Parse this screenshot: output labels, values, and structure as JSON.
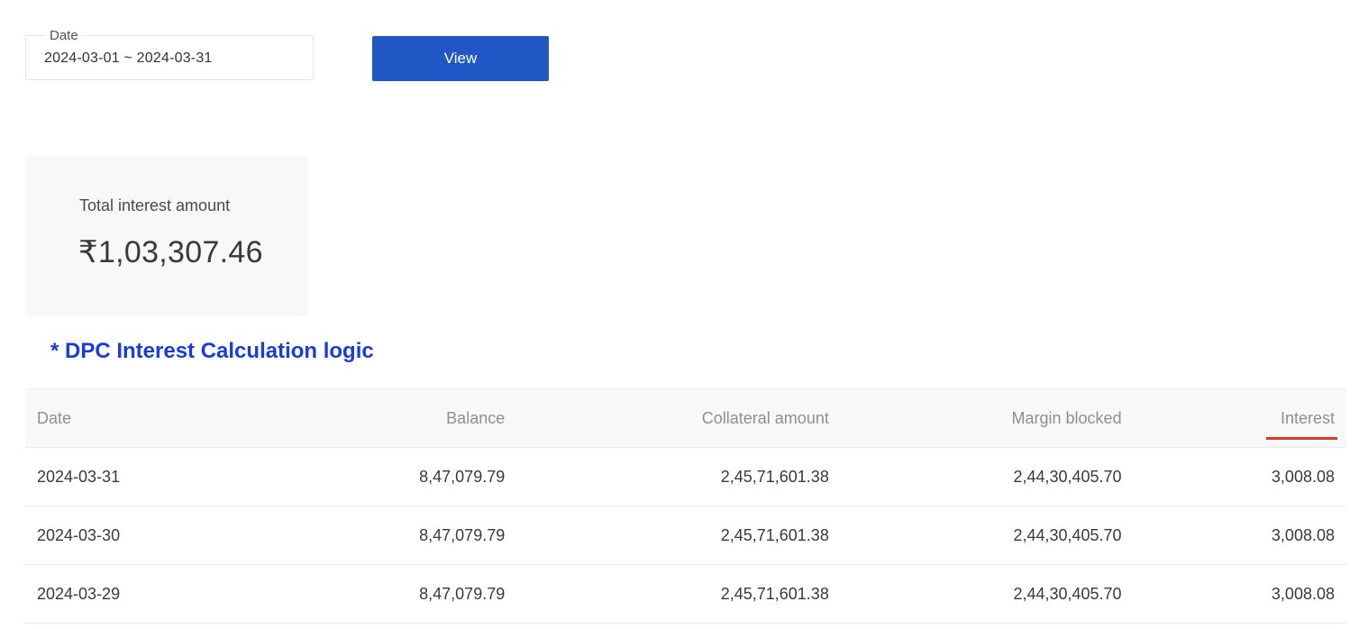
{
  "filter": {
    "date_label": "Date",
    "date_value": "2024-03-01 ~ 2024-03-31",
    "view_button_label": "View"
  },
  "summary": {
    "label": "Total interest amount",
    "amount": "₹1,03,307.46"
  },
  "logic_link": {
    "label": "* DPC Interest Calculation logic"
  },
  "table": {
    "headers": {
      "date": "Date",
      "balance": "Balance",
      "collateral": "Collateral amount",
      "margin": "Margin blocked",
      "interest": "Interest"
    },
    "sorted_column": "interest",
    "sort_indicator_color": "#d93a2c",
    "rows": [
      {
        "date": "2024-03-31",
        "balance": "8,47,079.79",
        "collateral": "2,45,71,601.38",
        "margin": "2,44,30,405.70",
        "interest": "3,008.08"
      },
      {
        "date": "2024-03-30",
        "balance": "8,47,079.79",
        "collateral": "2,45,71,601.38",
        "margin": "2,44,30,405.70",
        "interest": "3,008.08"
      },
      {
        "date": "2024-03-29",
        "balance": "8,47,079.79",
        "collateral": "2,45,71,601.38",
        "margin": "2,44,30,405.70",
        "interest": "3,008.08"
      }
    ]
  },
  "colors": {
    "primary_button": "#2157c4",
    "link": "#1a3be0",
    "card_background": "#f8f8f8"
  }
}
